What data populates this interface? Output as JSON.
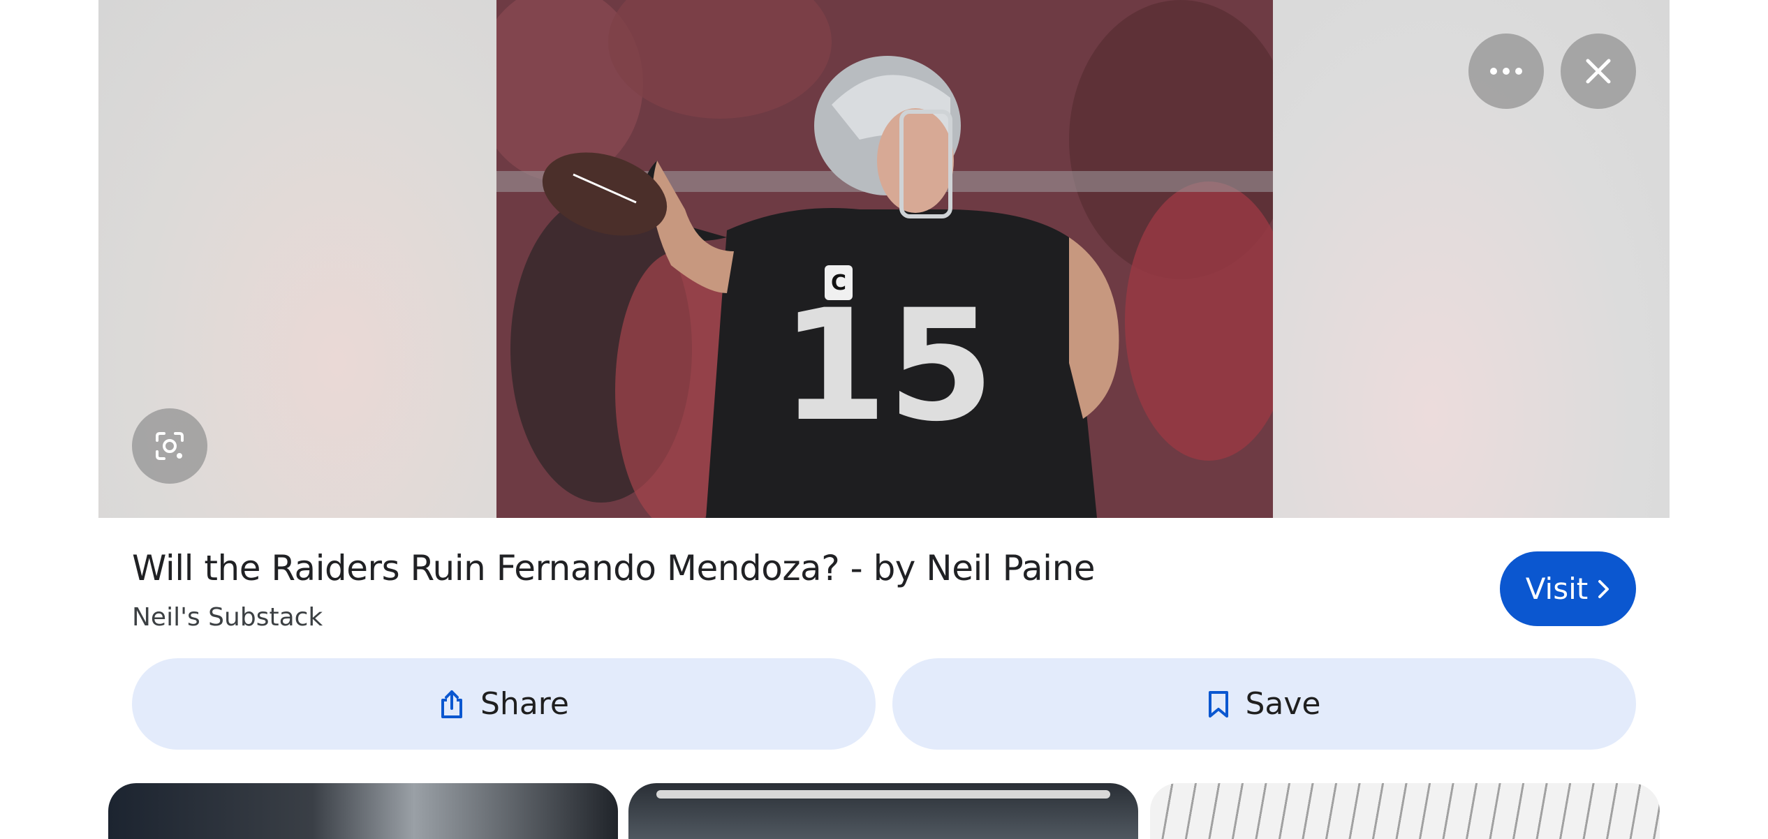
{
  "hero": {
    "more_icon": "more-horizontal-icon",
    "close_icon": "close-icon",
    "lens_icon": "google-lens-icon",
    "photo_jersey_number": "15"
  },
  "result": {
    "title": "Will the Raiders Ruin Fernando Mendoza? - by Neil Paine",
    "source": "Neil's Substack",
    "visit_label": "Visit",
    "visit_icon": "chevron-right-icon"
  },
  "actions": {
    "share_label": "Share",
    "share_icon": "share-icon",
    "save_label": "Save",
    "save_icon": "bookmark-icon"
  },
  "colors": {
    "accent": "#0b57d0",
    "action_bg": "#e3ebfb",
    "text": "#202124"
  }
}
